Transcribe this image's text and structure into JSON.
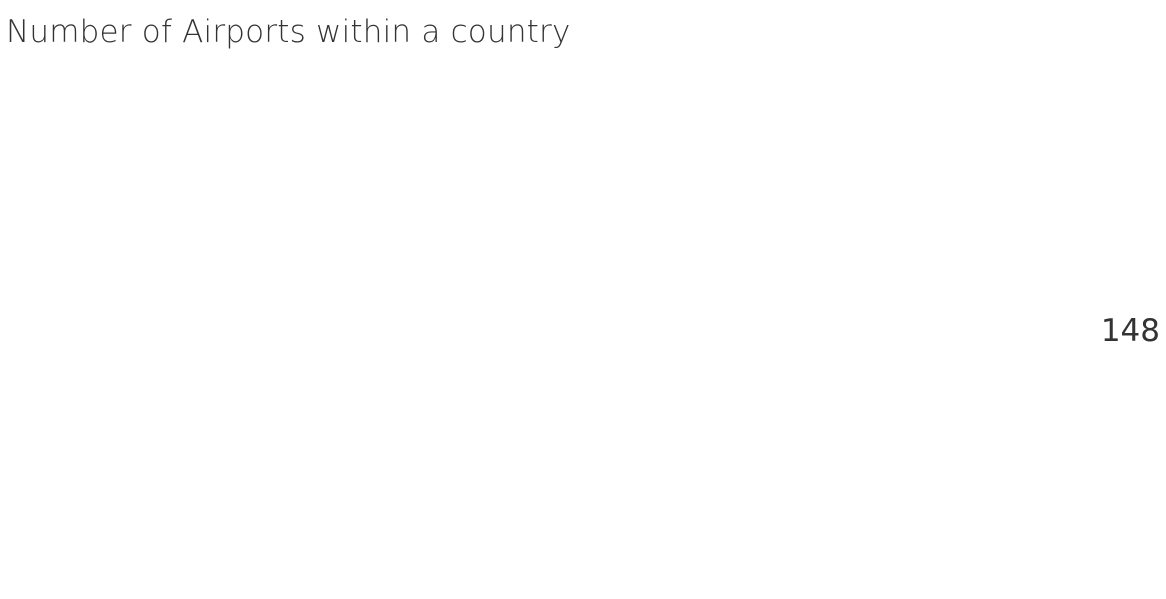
{
  "worksheet": {
    "title": "Number of Airports within a country",
    "value": "148"
  }
}
